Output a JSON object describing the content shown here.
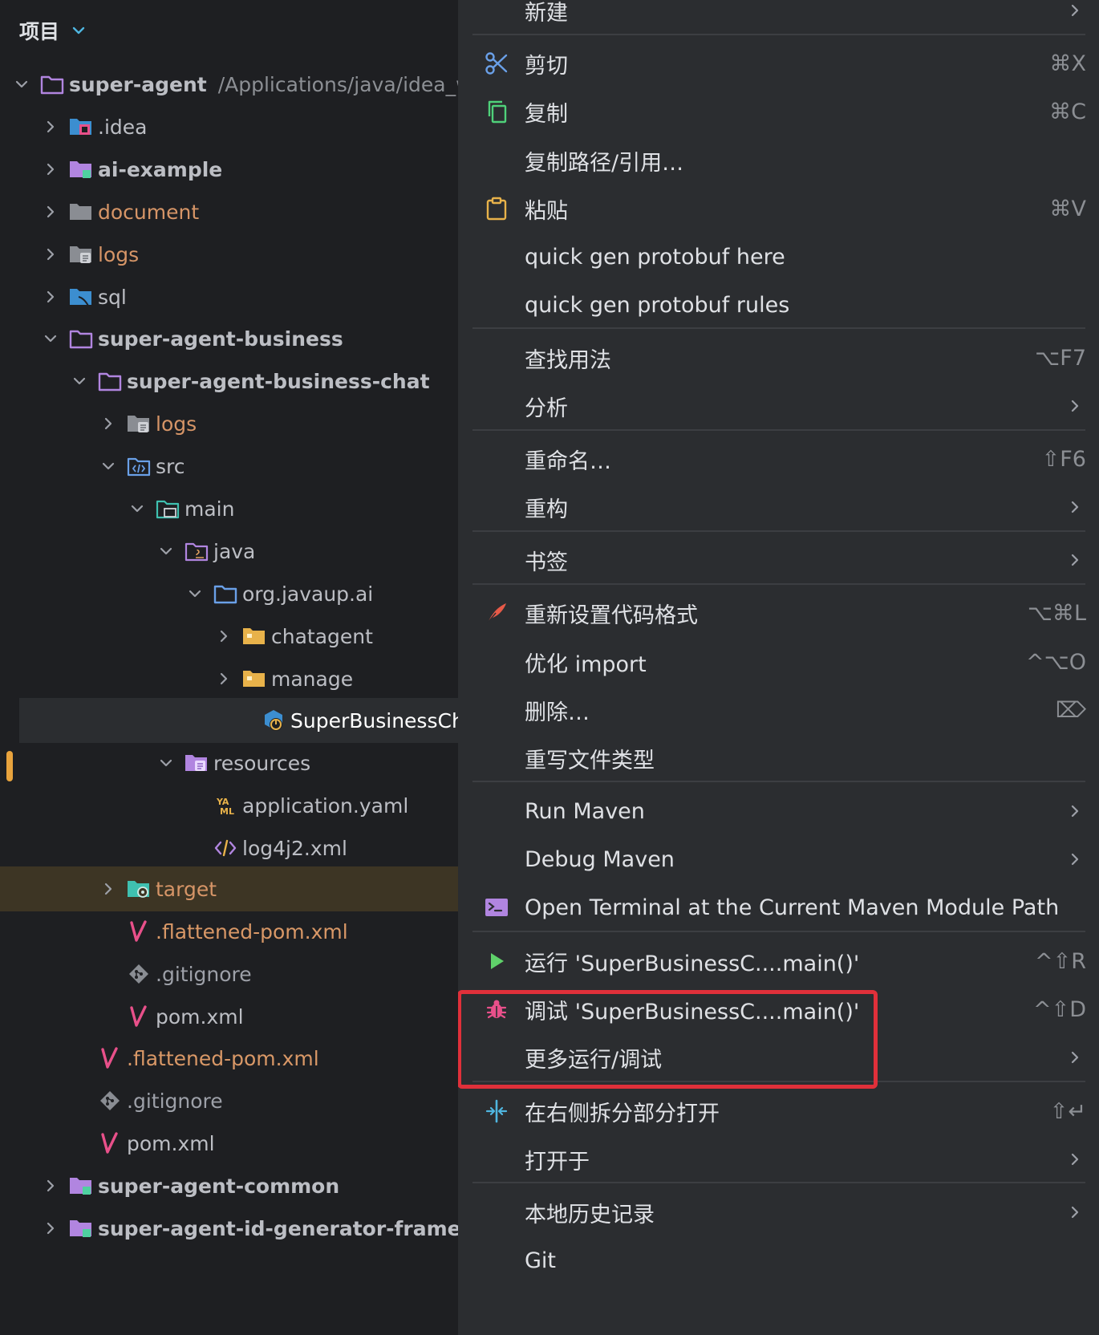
{
  "project_panel": {
    "title": "项目",
    "tree": [
      {
        "label": "super-agent",
        "path": "/Applications/java/idea_wo",
        "icon": "module-folder-icon"
      },
      {
        "label": ".idea",
        "icon": "idea-folder-icon"
      },
      {
        "label": "ai-example",
        "icon": "module-folder-icon"
      },
      {
        "label": "document",
        "icon": "folder-icon"
      },
      {
        "label": "logs",
        "icon": "folder-icon"
      },
      {
        "label": "sql",
        "icon": "database-folder-icon"
      },
      {
        "label": "super-agent-business",
        "icon": "folder-outline-icon"
      },
      {
        "label": "super-agent-business-chat",
        "icon": "folder-outline-icon"
      },
      {
        "label": "logs",
        "icon": "folder-icon"
      },
      {
        "label": "src",
        "icon": "source-folder-icon"
      },
      {
        "label": "main",
        "icon": "folder-icon"
      },
      {
        "label": "java",
        "icon": "source-root-icon"
      },
      {
        "label": "org.javaup.ai",
        "icon": "package-icon"
      },
      {
        "label": "chatagent",
        "icon": "folder-icon"
      },
      {
        "label": "manage",
        "icon": "folder-icon"
      },
      {
        "label": "SuperBusinessChat",
        "icon": "spring-boot-class-icon"
      },
      {
        "label": "resources",
        "icon": "resources-folder-icon"
      },
      {
        "label": "application.yaml",
        "icon": "yaml-file-icon"
      },
      {
        "label": "log4j2.xml",
        "icon": "xml-file-icon"
      },
      {
        "label": "target",
        "icon": "excluded-folder-icon"
      },
      {
        "label": ".flattened-pom.xml",
        "icon": "maven-file-icon"
      },
      {
        "label": ".gitignore",
        "icon": "git-file-icon"
      },
      {
        "label": "pom.xml",
        "icon": "maven-file-icon"
      },
      {
        "label": ".flattened-pom.xml",
        "icon": "maven-file-icon"
      },
      {
        "label": ".gitignore",
        "icon": "git-file-icon"
      },
      {
        "label": "pom.xml",
        "icon": "maven-file-icon"
      },
      {
        "label": "super-agent-common",
        "icon": "module-folder-icon"
      },
      {
        "label": "super-agent-id-generator-framewo",
        "icon": "module-folder-icon"
      }
    ]
  },
  "context_menu": {
    "items": [
      {
        "label": "新建",
        "shortcut": ""
      },
      {
        "label": "剪切",
        "shortcut": "⌘X"
      },
      {
        "label": "复制",
        "shortcut": "⌘C"
      },
      {
        "label": "复制路径/引用…",
        "shortcut": ""
      },
      {
        "label": "粘贴",
        "shortcut": "⌘V"
      },
      {
        "label": "quick gen protobuf here",
        "shortcut": ""
      },
      {
        "label": "quick gen protobuf rules",
        "shortcut": ""
      },
      {
        "label": "查找用法",
        "shortcut": "⌥F7"
      },
      {
        "label": "分析",
        "shortcut": ""
      },
      {
        "label": "重命名…",
        "shortcut": "⇧F6"
      },
      {
        "label": "重构",
        "shortcut": ""
      },
      {
        "label": "书签",
        "shortcut": ""
      },
      {
        "label": "重新设置代码格式",
        "shortcut": "⌥⌘L"
      },
      {
        "label": "优化 import",
        "shortcut": "^⌥O"
      },
      {
        "label": "删除…",
        "shortcut": "⌦"
      },
      {
        "label": "重写文件类型",
        "shortcut": ""
      },
      {
        "label": "Run Maven",
        "shortcut": ""
      },
      {
        "label": "Debug Maven",
        "shortcut": ""
      },
      {
        "label": "Open Terminal at the Current Maven Module Path",
        "shortcut": ""
      },
      {
        "label": "运行 'SuperBusinessC....main()'",
        "shortcut": "^⇧R"
      },
      {
        "label": "调试 'SuperBusinessC....main()'",
        "shortcut": "^⇧D"
      },
      {
        "label": "更多运行/调试",
        "shortcut": ""
      },
      {
        "label": "在右侧拆分部分打开",
        "shortcut": "⇧↵"
      },
      {
        "label": "打开于",
        "shortcut": ""
      },
      {
        "label": "本地历史记录",
        "shortcut": ""
      },
      {
        "label": "Git",
        "shortcut": ""
      }
    ]
  },
  "colors": {
    "menu_bg": "#2b2d30",
    "panel_bg": "#1e1f22",
    "highlight": "#e0303a",
    "selection_marker": "#e8a33d"
  }
}
